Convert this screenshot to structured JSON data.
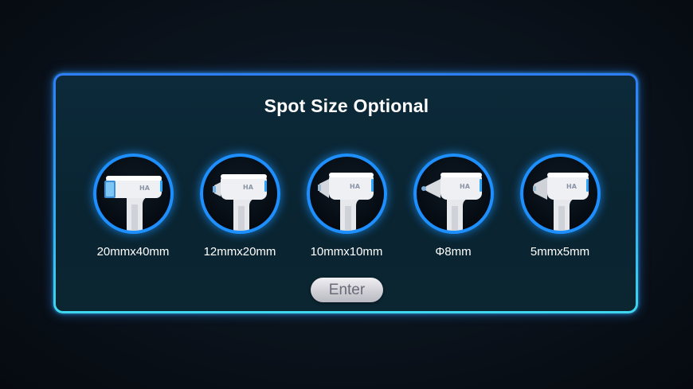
{
  "title": "Spot Size Optional",
  "options": [
    {
      "label": "20mmx40mm",
      "handpiece": "handpiece-20x40-icon"
    },
    {
      "label": "12mmx20mm",
      "handpiece": "handpiece-12x20-icon"
    },
    {
      "label": "10mmx10mm",
      "handpiece": "handpiece-10x10-icon"
    },
    {
      "label": "Φ8mm",
      "handpiece": "handpiece-phi8-icon"
    },
    {
      "label": "5mmx5mm",
      "handpiece": "handpiece-5x5-icon"
    }
  ],
  "enter_label": "Enter",
  "handpiece_brand": "HA",
  "colors": {
    "accent": "#1d8fff",
    "panel_border_top": "#2f7dfb",
    "panel_border_bottom": "#3fd6ee",
    "panel_bg": "#0c2a3a",
    "text": "#ffffff"
  }
}
